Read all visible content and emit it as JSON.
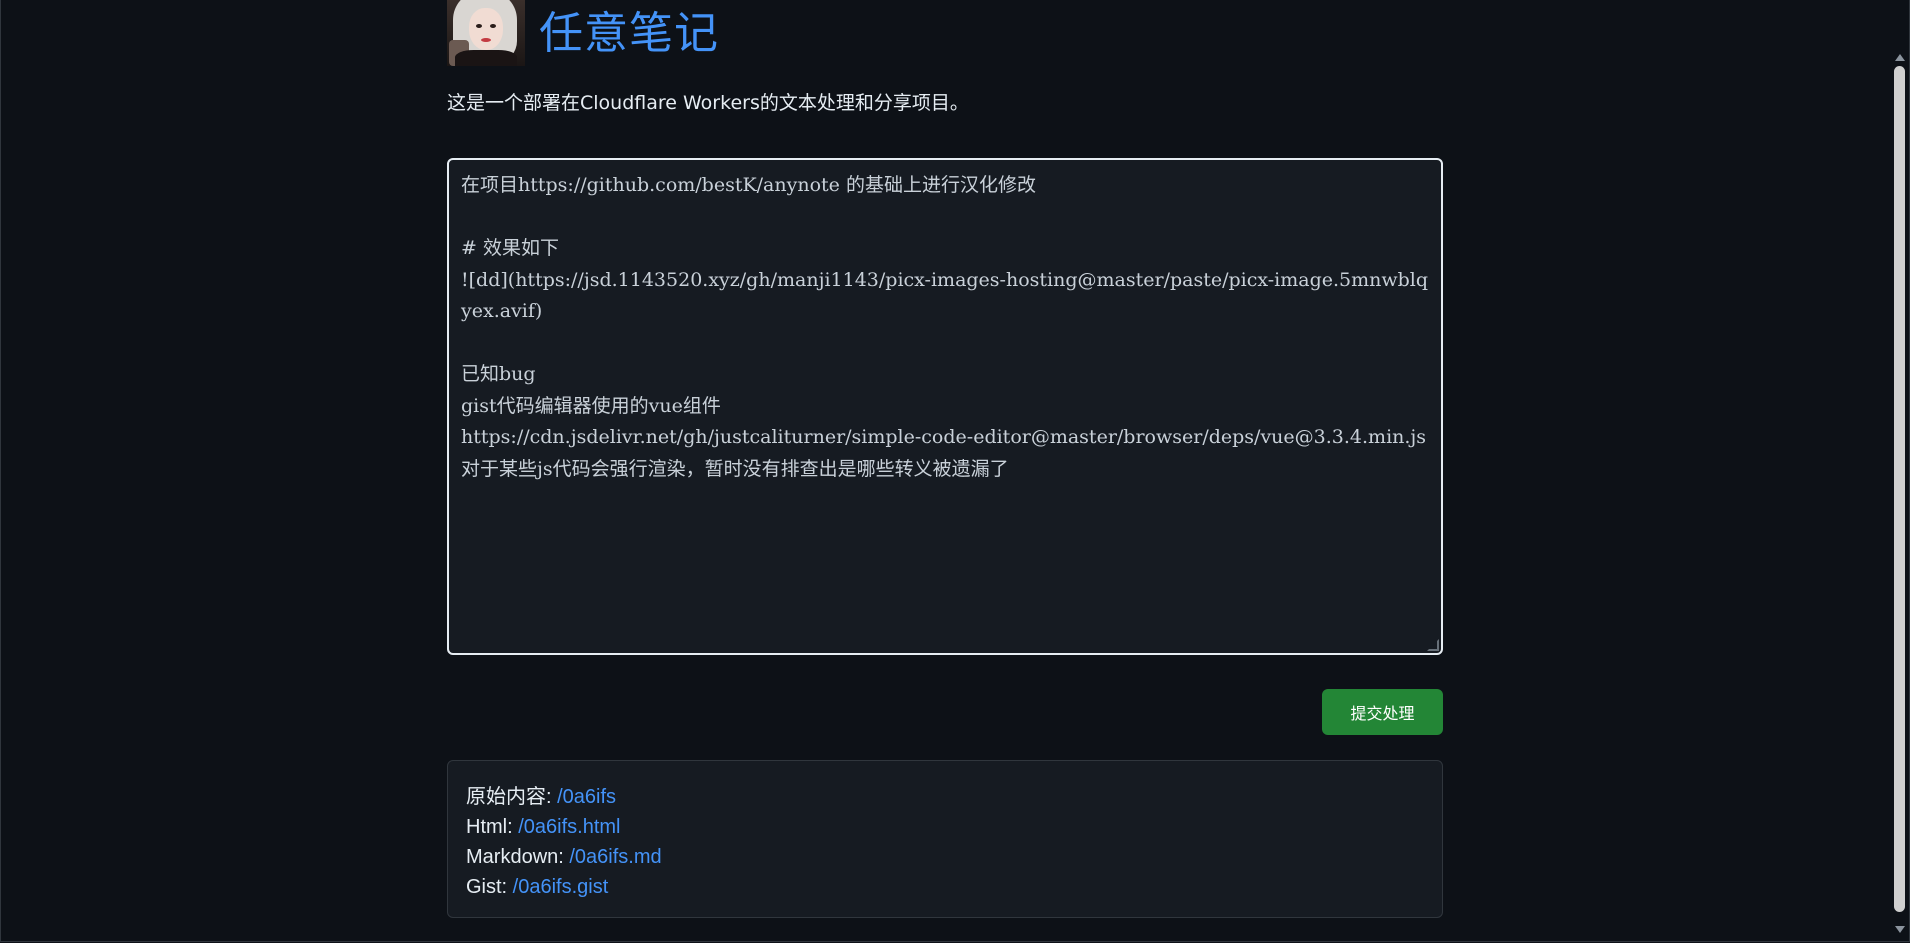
{
  "header": {
    "title": "任意笔记"
  },
  "description": "这是一个部署在Cloudflare Workers的文本处理和分享项目。",
  "editor": {
    "content": "在项目https://github.com/bestK/anynote 的基础上进行汉化修改\n\n# 效果如下\n![dd](https://jsd.1143520.xyz/gh/manji1143/picx-images-hosting@master/paste/picx-image.5mnwblqyex.avif)\n\n已知bug\ngist代码编辑器使用的vue组件\nhttps://cdn.jsdelivr.net/gh/justcaliturner/simple-code-editor@master/browser/deps/vue@3.3.4.min.js\n对于某些js代码会强行渲染，暂时没有排查出是哪些转义被遗漏了"
  },
  "submit": {
    "label": "提交处理"
  },
  "result": {
    "items": [
      {
        "label": "原始内容: ",
        "link": "/0a6ifs"
      },
      {
        "label": "Html: ",
        "link": "/0a6ifs.html"
      },
      {
        "label": "Markdown: ",
        "link": "/0a6ifs.md"
      },
      {
        "label": "Gist: ",
        "link": "/0a6ifs.gist"
      }
    ]
  },
  "colors": {
    "background": "#0d1117",
    "accent": "#4493f8",
    "submit": "#238636"
  }
}
